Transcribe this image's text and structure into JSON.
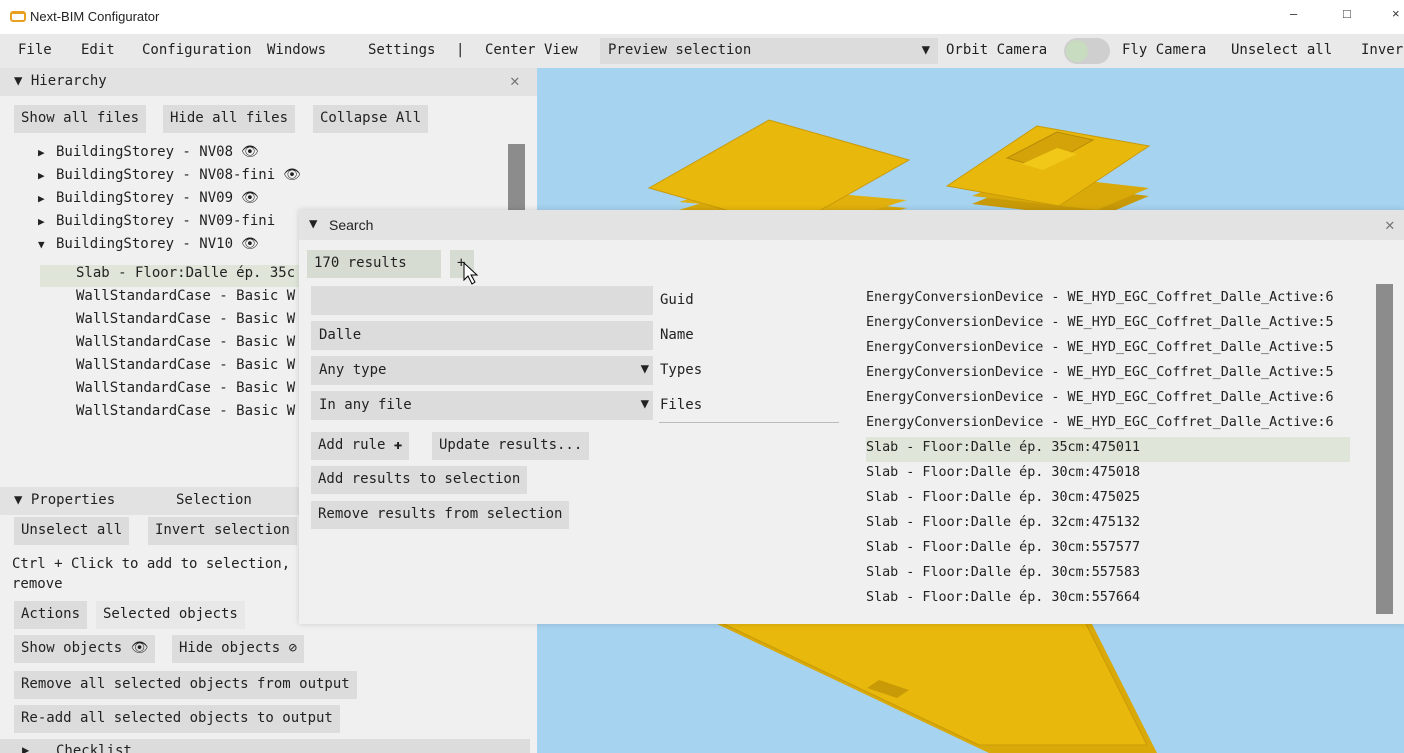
{
  "window": {
    "title": "Next-BIM Configurator",
    "minimize": "–",
    "maximize": "□",
    "close": "×"
  },
  "menu": {
    "file": "File",
    "edit": "Edit",
    "configuration": "Configuration",
    "windows": "Windows",
    "settings": "Settings",
    "separator": "|",
    "center_view": "Center View",
    "preview_select": "Preview selection",
    "dropdown_arrow": "▼",
    "orbit_camera": "Orbit Camera",
    "fly_camera": "Fly Camera",
    "unselect_all": "Unselect all",
    "invert": "Inver"
  },
  "hierarchy": {
    "header": "Hierarchy",
    "buttons": {
      "show_all": "Show all files",
      "hide_all": "Hide all files",
      "collapse_all": "Collapse All"
    },
    "tree": [
      {
        "label": "BuildingStorey - NV08",
        "expanded": false,
        "eye": "👁"
      },
      {
        "label": "BuildingStorey - NV08-fini",
        "expanded": false,
        "eye": "👁"
      },
      {
        "label": "BuildingStorey - NV09",
        "expanded": false,
        "eye": "👁"
      },
      {
        "label": "BuildingStorey - NV09-fini",
        "expanded": false,
        "eye": ""
      },
      {
        "label": "BuildingStorey - NV10",
        "expanded": true,
        "eye": "👁"
      }
    ],
    "children": [
      "Slab - Floor:Dalle ép. 35c",
      "WallStandardCase - Basic W",
      "WallStandardCase - Basic W",
      "WallStandardCase - Basic W",
      "WallStandardCase - Basic W",
      "WallStandardCase - Basic W",
      "WallStandardCase - Basic W"
    ]
  },
  "properties": {
    "header": "Properties",
    "selection_tab": "Selection",
    "unselect_all": "Unselect all",
    "invert_selection": "Invert selection",
    "hint_line1": "Ctrl + Click to add to selection,",
    "hint_line2": "remove",
    "tab_actions": "Actions",
    "tab_selected": "Selected objects",
    "show_objects": "Show objects",
    "hide_objects": "Hide objects",
    "remove_all": "Remove all selected objects from output",
    "readd_all": "Re-add all selected objects to output",
    "checklist": "Checklist"
  },
  "search": {
    "header": "Search",
    "results_count": "170 results",
    "add_tab": "+",
    "guid_value": "",
    "guid_label": "Guid",
    "name_value": "Dalle",
    "name_label": "Name",
    "types_value": "Any type",
    "types_label": "Types",
    "files_value": "In any file",
    "files_label": "Files",
    "add_rule": "Add rule",
    "update_results": "Update results...",
    "add_to_selection": "Add results to selection",
    "remove_from_selection": "Remove results from selection",
    "results": [
      "EnergyConversionDevice - WE_HYD_EGC_Coffret_Dalle_Active:6",
      "EnergyConversionDevice - WE_HYD_EGC_Coffret_Dalle_Active:5",
      "EnergyConversionDevice - WE_HYD_EGC_Coffret_Dalle_Active:5",
      "EnergyConversionDevice - WE_HYD_EGC_Coffret_Dalle_Active:5",
      "EnergyConversionDevice - WE_HYD_EGC_Coffret_Dalle_Active:6",
      "EnergyConversionDevice - WE_HYD_EGC_Coffret_Dalle_Active:6",
      "Slab - Floor:Dalle ép. 35cm:475011",
      "Slab - Floor:Dalle ép. 30cm:475018",
      "Slab - Floor:Dalle ép. 30cm:475025",
      "Slab - Floor:Dalle ép. 32cm:475132",
      "Slab - Floor:Dalle ép. 30cm:557577",
      "Slab - Floor:Dalle ép. 30cm:557583",
      "Slab - Floor:Dalle ép. 30cm:557664"
    ],
    "selected_index": 6
  },
  "colors": {
    "slab": "#e8b80c",
    "viewport": "#a6d3ef",
    "selected_row": "#dfe6d9",
    "scrollbar": "#8c8c8c"
  }
}
